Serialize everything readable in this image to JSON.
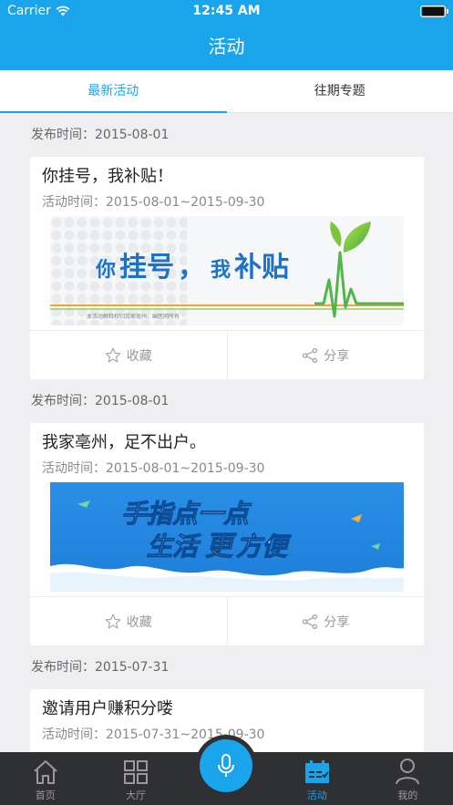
{
  "status": {
    "carrier": "Carrier",
    "time": "12:45 AM"
  },
  "header": {
    "title": "活动"
  },
  "tabs": [
    {
      "label": "最新活动",
      "active": true
    },
    {
      "label": "往期专题",
      "active": false
    }
  ],
  "posts": [
    {
      "date": "发布时间：2015-08-01",
      "title": "你挂号，我补贴！",
      "time": "活动时间：2015-08-01~2015-09-30",
      "banner": {
        "text_a": "你",
        "text_b": "挂号",
        "text_c": "，",
        "text_d": "我",
        "text_e": "补贴",
        "footnote": "本活动解释权归我家亳州，幽医网所有"
      },
      "fav_label": "收藏",
      "share_label": "分享"
    },
    {
      "date": "发布时间：2015-08-01",
      "title": "我家亳州，足不出户。",
      "time": "活动时间：2015-08-01~2015-09-30",
      "banner": {
        "line1": "手指点一点",
        "line2_a": "生活",
        "line2_b": "更",
        "line2_c": "方便"
      },
      "fav_label": "收藏",
      "share_label": "分享"
    },
    {
      "date": "发布时间：2015-07-31",
      "title": "邀请用户赚积分喽",
      "time": "活动时间：2015-07-31~2015-09-30"
    }
  ],
  "tabbar": [
    {
      "label": "首页",
      "icon": "home-icon",
      "active": false
    },
    {
      "label": "大厅",
      "icon": "grid-icon",
      "active": false
    },
    {
      "label": "",
      "icon": "microphone-icon",
      "active": false
    },
    {
      "label": "活动",
      "icon": "calendar-icon",
      "active": true
    },
    {
      "label": "我的",
      "icon": "user-icon",
      "active": false
    }
  ],
  "colors": {
    "accent": "#1aa4ec",
    "tabbar_bg": "#2f3033",
    "page_bg": "#efeff2"
  }
}
